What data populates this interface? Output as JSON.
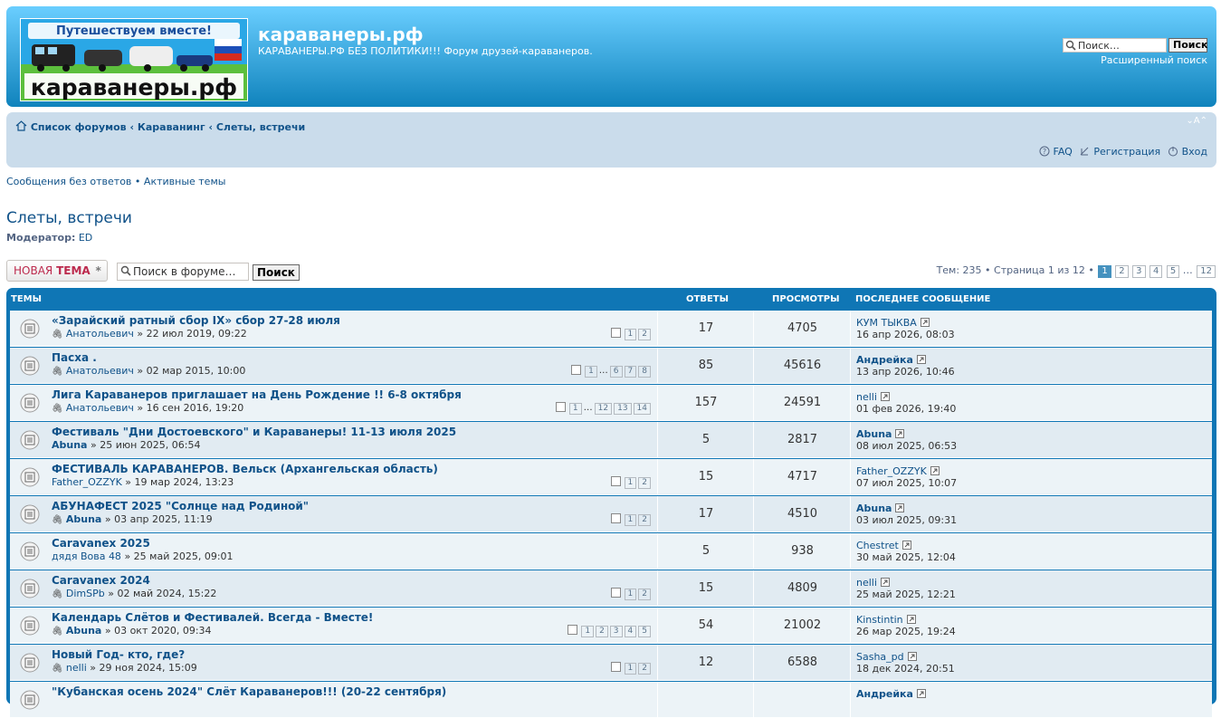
{
  "header": {
    "logo": {
      "line1": "Путешествуем вместе!",
      "line2": "караванеры.рф"
    },
    "site_title": "караванеры.рф",
    "site_desc": "КАРАВАНЕРЫ.РФ БЕЗ ПОЛИТИКИ!!! Форум друзей-караванеров.",
    "search_placeholder": "Поиск…",
    "search_button": "Поиск",
    "advanced_search": "Расширенный поиск"
  },
  "nav": {
    "crumbs": [
      "Список форумов",
      "Караванинг",
      "Слеты, встречи"
    ],
    "crumb_sep": "‹",
    "font_size": "A",
    "faq": "FAQ",
    "register": "Регистрация",
    "login": "Вход"
  },
  "quick_links": {
    "unanswered": "Сообщения без ответов",
    "sep": "•",
    "active": "Активные темы"
  },
  "forum": {
    "title": "Слеты, встречи",
    "moderator_label": "Модератор:",
    "moderator": "ED",
    "new_topic_a": "НОВАЯ ",
    "new_topic_b": "ТЕМА",
    "search_placeholder": "Поиск в форуме…",
    "search_button": "Поиск",
    "pagination": {
      "summary": "Тем: 235 • Страница 1 из 12 •",
      "pages": [
        "1",
        "2",
        "3",
        "4",
        "5"
      ],
      "ellipsis": "…",
      "last": "12"
    }
  },
  "table": {
    "headers": {
      "topics": "ТЕМЫ",
      "replies": "ОТВЕТЫ",
      "views": "ПРОСМОТРЫ",
      "last": "ПОСЛЕДНЕЕ СООБЩЕНИЕ"
    },
    "rows": [
      {
        "title": "«Зарайский ратный сбор IX» сбор 27-28 июля",
        "attach": true,
        "author": "Анатольевич",
        "author_bold": false,
        "date": "» 22 июл 2019, 09:22",
        "pages": [
          "1",
          "2"
        ],
        "replies": "17",
        "views": "4705",
        "last_author": "КУМ ТЫКВА",
        "last_bold": false,
        "last_date": "16 апр 2026, 08:03"
      },
      {
        "title": "Пасха .",
        "attach": true,
        "author": "Анатольевич",
        "author_bold": false,
        "date": "» 02 мар 2015, 10:00",
        "pages": [
          "1",
          "…",
          "6",
          "7",
          "8"
        ],
        "replies": "85",
        "views": "45616",
        "last_author": "Андрейка",
        "last_bold": true,
        "last_date": "13 апр 2026, 10:46"
      },
      {
        "title": "Лига Караванеров приглашает на День Рождение !! 6-8 октября",
        "attach": true,
        "author": "Анатольевич",
        "author_bold": false,
        "date": "» 16 сен 2016, 19:20",
        "pages": [
          "1",
          "…",
          "12",
          "13",
          "14"
        ],
        "replies": "157",
        "views": "24591",
        "last_author": "nelli",
        "last_bold": false,
        "last_date": "01 фев 2026, 19:40"
      },
      {
        "title": "Фестиваль \"Дни Достоевского\" и Караванеры! 11-13 июля 2025",
        "attach": false,
        "author": "Abuna",
        "author_bold": true,
        "date": "» 25 июн 2025, 06:54",
        "pages": [],
        "replies": "5",
        "views": "2817",
        "last_author": "Abuna",
        "last_bold": true,
        "last_date": "08 июл 2025, 06:53"
      },
      {
        "title": "ФЕСТИВАЛЬ КАРАВАНЕРОВ. Вельск (Архангельская область)",
        "attach": false,
        "author": "Father_OZZYK",
        "author_bold": false,
        "date": "» 19 мар 2024, 13:23",
        "pages": [
          "1",
          "2"
        ],
        "replies": "15",
        "views": "4717",
        "last_author": "Father_OZZYK",
        "last_bold": false,
        "last_date": "07 июл 2025, 10:07"
      },
      {
        "title": "АБУНАФЕСТ 2025 \"Солнце над Родиной\"",
        "attach": true,
        "author": "Abuna",
        "author_bold": true,
        "date": "» 03 апр 2025, 11:19",
        "pages": [
          "1",
          "2"
        ],
        "replies": "17",
        "views": "4510",
        "last_author": "Abuna",
        "last_bold": true,
        "last_date": "03 июл 2025, 09:31"
      },
      {
        "title": "Caravanex 2025",
        "attach": false,
        "author": "дядя Вова 48",
        "author_bold": false,
        "date": "» 25 май 2025, 09:01",
        "pages": [],
        "replies": "5",
        "views": "938",
        "last_author": "Chestret",
        "last_bold": false,
        "last_date": "30 май 2025, 12:04"
      },
      {
        "title": "Caravanex 2024",
        "attach": true,
        "author": "DimSPb",
        "author_bold": false,
        "date": "» 02 май 2024, 15:22",
        "pages": [
          "1",
          "2"
        ],
        "replies": "15",
        "views": "4809",
        "last_author": "nelli",
        "last_bold": false,
        "last_date": "25 май 2025, 12:21"
      },
      {
        "title": "Календарь Слётов и Фестивалей. Всегда - Вместе!",
        "attach": true,
        "author": "Abuna",
        "author_bold": true,
        "date": "» 03 окт 2020, 09:34",
        "pages": [
          "1",
          "2",
          "3",
          "4",
          "5"
        ],
        "replies": "54",
        "views": "21002",
        "last_author": "Kinstintin",
        "last_bold": false,
        "last_date": "26 мар 2025, 19:24"
      },
      {
        "title": "Новый Год- кто, где?",
        "attach": true,
        "author": "nelli",
        "author_bold": false,
        "date": "» 29 ноя 2024, 15:09",
        "pages": [
          "1",
          "2"
        ],
        "replies": "12",
        "views": "6588",
        "last_author": "Sasha_pd",
        "last_bold": false,
        "last_date": "18 дек 2024, 20:51"
      },
      {
        "title": "\"Кубанская осень 2024\" Слёт Караванеров!!! (20-22 сентября)",
        "attach": false,
        "author": "",
        "author_bold": false,
        "date": "",
        "pages": [],
        "replies": "",
        "views": "",
        "last_author": "Андрейка",
        "last_bold": true,
        "last_date": ""
      }
    ]
  },
  "colors": {
    "header_top": "#6aceff",
    "header_bottom": "#0076b1",
    "nav_bg": "#cadceb",
    "table_blue": "#0f76b5",
    "row_light": "#ecf3f7",
    "row_dark": "#e1ebf2",
    "link": "#105289",
    "new_topic_red": "#bc2a4d"
  }
}
